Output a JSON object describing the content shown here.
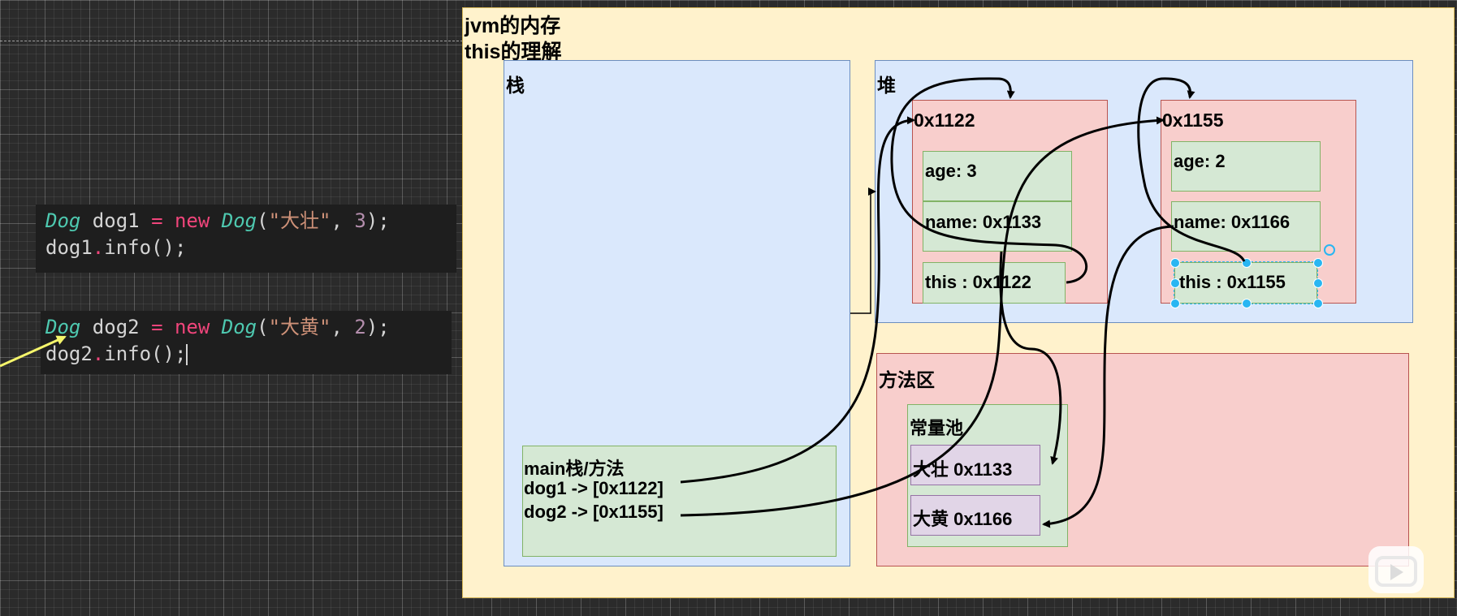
{
  "code": {
    "block1": {
      "line1": {
        "type1": "Dog",
        "var": " dog1 ",
        "eq": "=",
        "new": " new ",
        "type2": "Dog",
        "open": "(",
        "str": "\"大壮\"",
        "comma": ", ",
        "num": "3",
        "close": ");"
      },
      "line2": {
        "obj": "dog1",
        "dot": ".",
        "call": "info();"
      }
    },
    "block2": {
      "line1": {
        "type1": "Dog",
        "var": " dog2 ",
        "eq": "=",
        "new": " new ",
        "type2": "Dog",
        "open": "(",
        "str": "\"大黄\"",
        "comma": ", ",
        "num": "2",
        "close": ");"
      },
      "line2": {
        "obj": "dog2",
        "dot": ".",
        "call": "info();"
      }
    }
  },
  "diagram": {
    "title_line1": "jvm的内存",
    "title_line2": "this的理解",
    "stack": {
      "label": "栈",
      "main_frame": {
        "line1": "main栈/方法",
        "line2": "dog1 -> [0x1122]",
        "line3": "dog2 -> [0x1155]"
      }
    },
    "heap": {
      "label": "堆",
      "objects": [
        {
          "address": "0x1122",
          "age": "age: 3",
          "name": "name: 0x1133",
          "this": "this : 0x1122"
        },
        {
          "address": "0x1155",
          "age": "age: 2",
          "name": "name: 0x1166",
          "this": "this : 0x1155"
        }
      ]
    },
    "method_area": {
      "label": "方法区",
      "constant_pool": {
        "label": "常量池",
        "entries": [
          "大壮 0x1133",
          "大黄 0x1166"
        ]
      }
    }
  },
  "colors": {
    "canvas_bg": "#fff2cc",
    "blue_box": "#dae8fc",
    "red_box": "#f8cecc",
    "green_box": "#d5e8d4",
    "purple_box": "#e1d5e7",
    "selection": "#29b6f2",
    "pointer_arrow": "#f5f56b"
  }
}
